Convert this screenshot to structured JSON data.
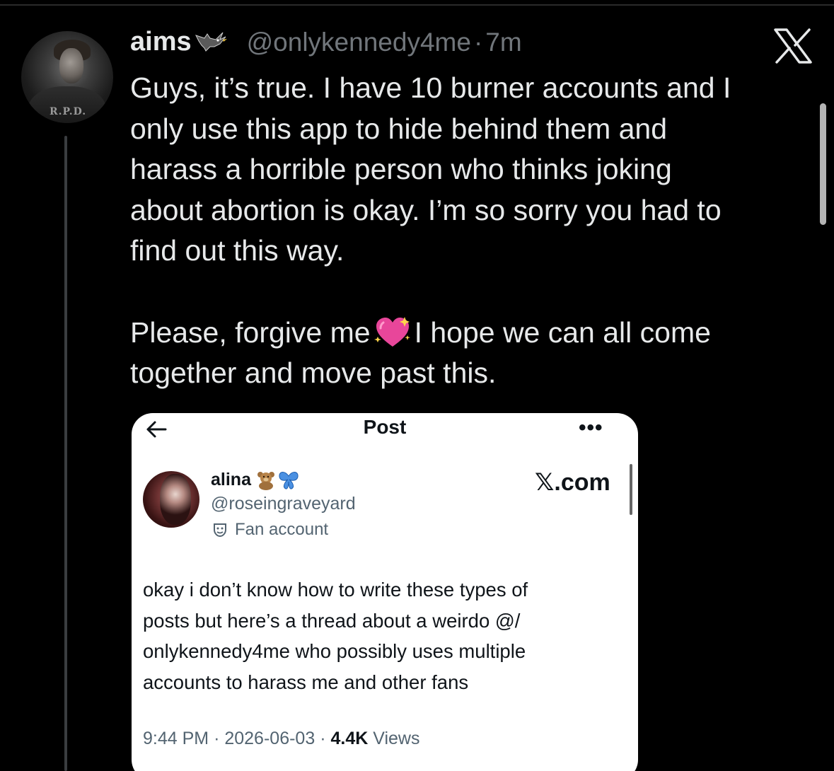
{
  "tweet": {
    "display_name": "aims",
    "handle": "@onlykennedy4me",
    "separator": "·",
    "time": "7m",
    "paragraph1": "Guys, it’s true. I have 10 burner accounts and I\nonly use this app to hide behind them and\nharass a horrible person who thinks joking\nabout abortion is okay. I’m so sorry you had to\nfind out this way.",
    "paragraph2_before_emoji": "Please, forgive me",
    "paragraph2_after_emoji": "I hope we can all come\ntogether and move past this.",
    "icons": {
      "name_emoji": "blackbird-icon",
      "inline_emoji": "sparkling-heart-icon",
      "corner_logo": "x-logo-icon"
    }
  },
  "embedded_post": {
    "header_title": "Post",
    "more_label": "•••",
    "display_name": "alina",
    "handle": "@roseingraveyard",
    "account_label": "Fan account",
    "watermark": "𝕏.com",
    "text": "okay i don’t know how to write these types of\nposts but here’s a thread about a weirdo @/\nonlykennedy4me who possibly uses multiple\naccounts to harass me and other fans",
    "time": "9:44 PM",
    "date": "2026-06-03",
    "views_count": "4.4K",
    "views_label": "Views",
    "meta_separator": "·"
  },
  "colors": {
    "background": "#000000",
    "primary_text": "#e7e9ea",
    "secondary_text": "#71767b",
    "card_background": "#ffffff",
    "card_secondary_text": "#536471"
  }
}
